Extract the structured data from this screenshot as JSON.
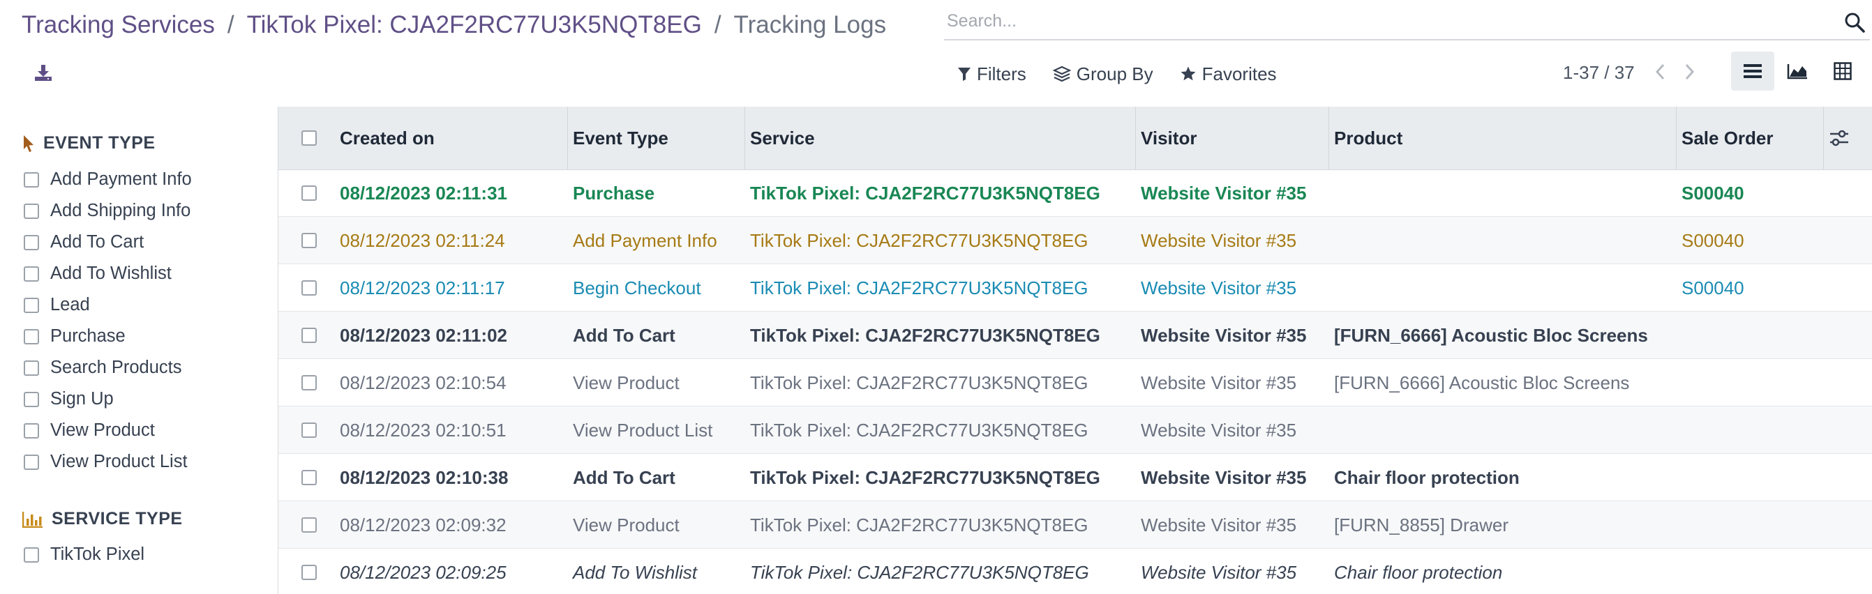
{
  "breadcrumb": {
    "items": [
      "Tracking Services",
      "TikTok Pixel: CJA2F2RC77U3K5NQT8EG"
    ],
    "separator": "/",
    "current": "Tracking Logs"
  },
  "search": {
    "placeholder": "Search...",
    "value": ""
  },
  "filters": {
    "filters_label": "Filters",
    "group_by_label": "Group By",
    "favorites_label": "Favorites"
  },
  "pager": {
    "value": "1-37 / 37"
  },
  "colors": {
    "brand": "#5f4f86",
    "success": "#198754",
    "warning": "#a67a15",
    "info": "#1a8bb3",
    "muted": "#6b7280",
    "header_bg": "#e9ecef",
    "event_type_icon": "#a25d1c",
    "service_type_icon": "#c78a1a"
  },
  "icons": {
    "download": "download-icon",
    "search": "search-icon",
    "filters": "filter-icon",
    "group_by": "layers-icon",
    "favorites": "star-icon",
    "list_view": "list-view-icon",
    "graph_view": "area-chart-icon",
    "pivot_view": "pivot-table-icon",
    "event_type": "pointer-icon",
    "service_type": "bar-chart-icon"
  },
  "search_panel": {
    "event_type": {
      "title": "EVENT TYPE",
      "items": [
        "Add Payment Info",
        "Add Shipping Info",
        "Add To Cart",
        "Add To Wishlist",
        "Lead",
        "Purchase",
        "Search Products",
        "Sign Up",
        "View Product",
        "View Product List"
      ]
    },
    "service_type": {
      "title": "SERVICE TYPE",
      "items": [
        "TikTok Pixel"
      ]
    }
  },
  "table": {
    "columns": [
      "Created on",
      "Event Type",
      "Service",
      "Visitor",
      "Product",
      "Sale Order"
    ],
    "rows": [
      {
        "created_on": "08/12/2023 02:11:31",
        "event_type": "Purchase",
        "service": "TikTok Pixel: CJA2F2RC77U3K5NQT8EG",
        "visitor": "Website Visitor #35",
        "product": "",
        "sale_order": "S00040",
        "style": "success-bold"
      },
      {
        "created_on": "08/12/2023 02:11:24",
        "event_type": "Add Payment Info",
        "service": "TikTok Pixel: CJA2F2RC77U3K5NQT8EG",
        "visitor": "Website Visitor #35",
        "product": "",
        "sale_order": "S00040",
        "style": "warning"
      },
      {
        "created_on": "08/12/2023 02:11:17",
        "event_type": "Begin Checkout",
        "service": "TikTok Pixel: CJA2F2RC77U3K5NQT8EG",
        "visitor": "Website Visitor #35",
        "product": "",
        "sale_order": "S00040",
        "style": "info"
      },
      {
        "created_on": "08/12/2023 02:11:02",
        "event_type": "Add To Cart",
        "service": "TikTok Pixel: CJA2F2RC77U3K5NQT8EG",
        "visitor": "Website Visitor #35",
        "product": "[FURN_6666] Acoustic Bloc Screens",
        "sale_order": "",
        "style": "bold"
      },
      {
        "created_on": "08/12/2023 02:10:54",
        "event_type": "View Product",
        "service": "TikTok Pixel: CJA2F2RC77U3K5NQT8EG",
        "visitor": "Website Visitor #35",
        "product": "[FURN_6666] Acoustic Bloc Screens",
        "sale_order": "",
        "style": "muted"
      },
      {
        "created_on": "08/12/2023 02:10:51",
        "event_type": "View Product List",
        "service": "TikTok Pixel: CJA2F2RC77U3K5NQT8EG",
        "visitor": "Website Visitor #35",
        "product": "",
        "sale_order": "",
        "style": "muted"
      },
      {
        "created_on": "08/12/2023 02:10:38",
        "event_type": "Add To Cart",
        "service": "TikTok Pixel: CJA2F2RC77U3K5NQT8EG",
        "visitor": "Website Visitor #35",
        "product": "Chair floor protection",
        "sale_order": "",
        "style": "bold"
      },
      {
        "created_on": "08/12/2023 02:09:32",
        "event_type": "View Product",
        "service": "TikTok Pixel: CJA2F2RC77U3K5NQT8EG",
        "visitor": "Website Visitor #35",
        "product": "[FURN_8855] Drawer",
        "sale_order": "",
        "style": "muted"
      },
      {
        "created_on": "08/12/2023 02:09:25",
        "event_type": "Add To Wishlist",
        "service": "TikTok Pixel: CJA2F2RC77U3K5NQT8EG",
        "visitor": "Website Visitor #35",
        "product": "Chair floor protection",
        "sale_order": "",
        "style": "italic"
      }
    ]
  }
}
